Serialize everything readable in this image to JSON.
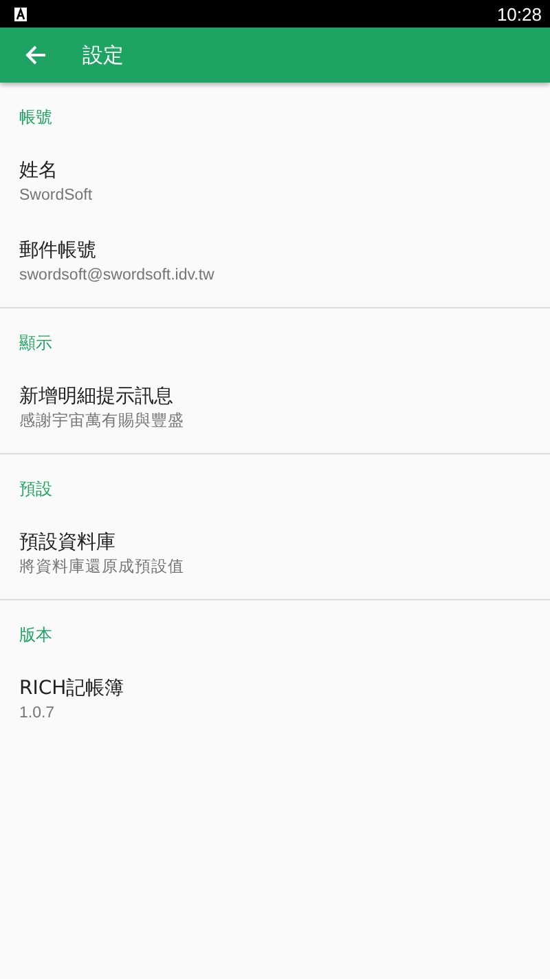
{
  "status_bar": {
    "time": "10:28"
  },
  "app_bar": {
    "title": "設定"
  },
  "sections": [
    {
      "title": "帳號",
      "items": [
        {
          "title": "姓名",
          "summary": "SwordSoft"
        },
        {
          "title": "郵件帳號",
          "summary": "swordsoft@swordsoft.idv.tw"
        }
      ]
    },
    {
      "title": "顯示",
      "items": [
        {
          "title": "新增明細提示訊息",
          "summary": "感謝宇宙萬有賜與豐盛"
        }
      ]
    },
    {
      "title": "預設",
      "items": [
        {
          "title": "預設資料庫",
          "summary": "將資料庫還原成預設值"
        }
      ]
    },
    {
      "title": "版本",
      "items": [
        {
          "title": "RICH記帳簿",
          "summary": "1.0.7"
        }
      ]
    }
  ]
}
